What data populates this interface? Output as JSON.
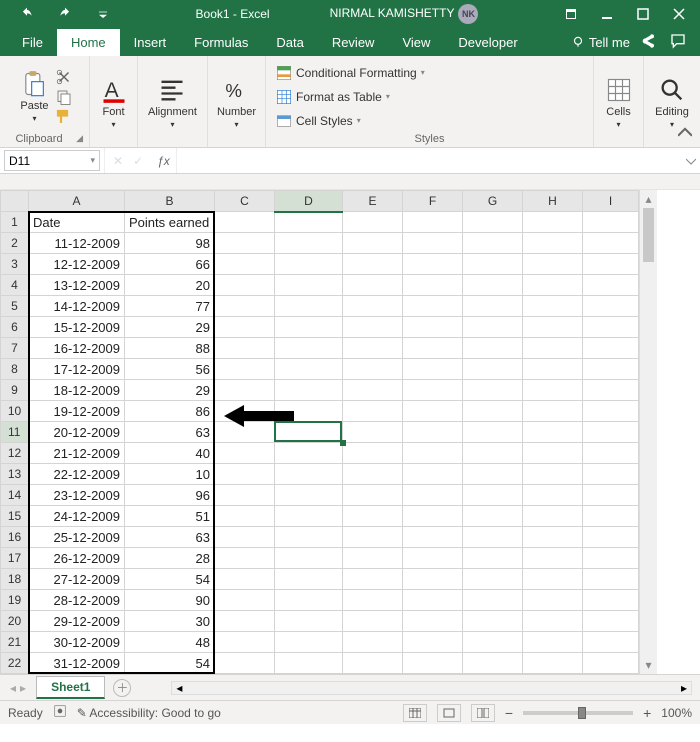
{
  "title": "Book1 - Excel",
  "user": {
    "name": "NIRMAL KAMISHETTY",
    "initials": "NK"
  },
  "tabs": [
    "File",
    "Home",
    "Insert",
    "Formulas",
    "Data",
    "Review",
    "View",
    "Developer"
  ],
  "active_tab": "Home",
  "tellme": "Tell me",
  "ribbon": {
    "clipboard": {
      "label": "Clipboard",
      "paste": "Paste"
    },
    "font": {
      "label": "Font"
    },
    "alignment": {
      "label": "Alignment"
    },
    "number": {
      "label": "Number"
    },
    "styles": {
      "label": "Styles",
      "cond": "Conditional Formatting",
      "table": "Format as Table",
      "cell": "Cell Styles"
    },
    "cells": {
      "label": "Cells"
    },
    "editing": {
      "label": "Editing"
    }
  },
  "name_box": "D11",
  "formula": "",
  "columns": [
    "A",
    "B",
    "C",
    "D",
    "E",
    "F",
    "G",
    "H",
    "I"
  ],
  "selected_col_idx": 3,
  "selected_row": 11,
  "headers": {
    "A": "Date",
    "B": "Points earned"
  },
  "rows": [
    {
      "r": 1,
      "A": "Date",
      "B": "Points earned"
    },
    {
      "r": 2,
      "A": "11-12-2009",
      "B": "98"
    },
    {
      "r": 3,
      "A": "12-12-2009",
      "B": "66"
    },
    {
      "r": 4,
      "A": "13-12-2009",
      "B": "20"
    },
    {
      "r": 5,
      "A": "14-12-2009",
      "B": "77"
    },
    {
      "r": 6,
      "A": "15-12-2009",
      "B": "29"
    },
    {
      "r": 7,
      "A": "16-12-2009",
      "B": "88"
    },
    {
      "r": 8,
      "A": "17-12-2009",
      "B": "56"
    },
    {
      "r": 9,
      "A": "18-12-2009",
      "B": "29"
    },
    {
      "r": 10,
      "A": "19-12-2009",
      "B": "86"
    },
    {
      "r": 11,
      "A": "20-12-2009",
      "B": "63"
    },
    {
      "r": 12,
      "A": "21-12-2009",
      "B": "40"
    },
    {
      "r": 13,
      "A": "22-12-2009",
      "B": "10"
    },
    {
      "r": 14,
      "A": "23-12-2009",
      "B": "96"
    },
    {
      "r": 15,
      "A": "24-12-2009",
      "B": "51"
    },
    {
      "r": 16,
      "A": "25-12-2009",
      "B": "63"
    },
    {
      "r": 17,
      "A": "26-12-2009",
      "B": "28"
    },
    {
      "r": 18,
      "A": "27-12-2009",
      "B": "54"
    },
    {
      "r": 19,
      "A": "28-12-2009",
      "B": "90"
    },
    {
      "r": 20,
      "A": "29-12-2009",
      "B": "30"
    },
    {
      "r": 21,
      "A": "30-12-2009",
      "B": "48"
    },
    {
      "r": 22,
      "A": "31-12-2009",
      "B": "54"
    }
  ],
  "sheet_tab": "Sheet1",
  "status": {
    "ready": "Ready",
    "access": "Accessibility: Good to go",
    "zoom": "100%"
  }
}
